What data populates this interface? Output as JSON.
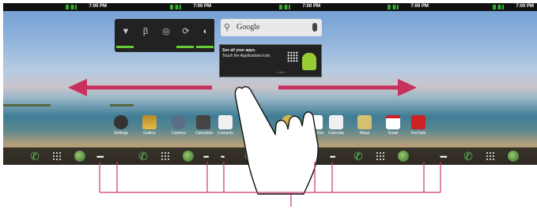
{
  "status_bar": {
    "time": "7:00 PM"
  },
  "search": {
    "placeholder": "Google"
  },
  "tip": {
    "title": "See all your apps.",
    "body": "Touch the Applications icon.",
    "page": "1 of 4"
  },
  "apps": [
    {
      "label": "Settings",
      "color": "#333333",
      "icon": "gear-icon"
    },
    {
      "label": "Gallery",
      "color": "#d99a2b",
      "icon": "gallery-icon"
    },
    {
      "label": "Camera",
      "color": "#5a6e86",
      "icon": "camera-icon"
    },
    {
      "label": "Calculator",
      "color": "#444444",
      "icon": "calculator-icon"
    },
    {
      "label": "Contacts",
      "color": "#ffffff",
      "icon": "contacts-icon"
    },
    {
      "label": "Play Store",
      "color": "#ffffff",
      "icon": "play-store-icon"
    },
    {
      "label": "Calendar",
      "color": "#f0f0f0",
      "icon": "calendar-icon"
    },
    {
      "label": "Maps",
      "color": "#d5c070",
      "icon": "maps-icon"
    },
    {
      "label": "Gmail",
      "color": "#ffffff",
      "icon": "gmail-icon"
    },
    {
      "label": "YouTube",
      "color": "#cc2222",
      "icon": "youtube-icon"
    }
  ],
  "colors": {
    "arrow": "#c8315e",
    "bracket": "#cc3377",
    "dock_green": "#5cc35c"
  }
}
